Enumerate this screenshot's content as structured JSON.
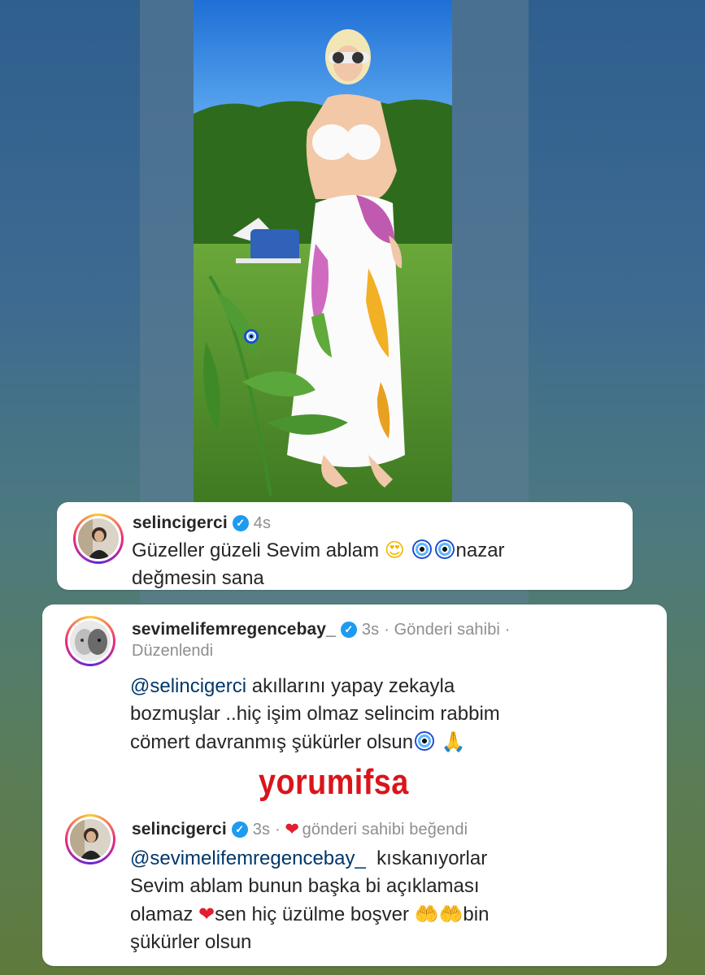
{
  "post": {
    "image_alt": "woman in white floral bikini and sarong standing on lawn",
    "evil_eye_sticker": "nazar-boncugu-icon"
  },
  "comments": [
    {
      "username": "selincigerci",
      "verified": true,
      "time": "4s",
      "meta_extra": "",
      "edited": "",
      "text_parts": [
        "Güzeller güzeli Sevim ablam",
        "nazar",
        "değmesin sana"
      ],
      "emoji": [
        "smiling-face-with-heart-eyes",
        "nazar-boncugu",
        "nazar-boncugu"
      ]
    },
    {
      "username": "sevimelifemregencebay_",
      "verified": true,
      "time": "3s",
      "meta_extra": "· Gönderi sahibi ·",
      "edited": "Düzenlendi",
      "mention": "@selincigerci",
      "text_parts": [
        "akıllarını yapay zekayla",
        "bozmuşlar ..hiç işim olmaz selincim  rabbim",
        "cömert davranmış şükürler  olsun"
      ],
      "emoji": [
        "nazar-boncugu",
        "folded-hands"
      ]
    },
    {
      "username": "selincigerci",
      "verified": true,
      "time": "3s",
      "meta_extra": "·",
      "liked_text": "gönderi sahibi beğendi",
      "mention": "@sevimelifemregencebay_",
      "text_parts": [
        "kıskanıyorlar",
        "Sevim ablam bunun başka bi açıklaması",
        "olamaz",
        "sen hiç üzülme boşver",
        "bin",
        "şükürler olsun"
      ],
      "emoji": [
        "red-heart",
        "palms-up",
        "palms-up"
      ]
    }
  ],
  "watermark": "yorumifsa",
  "colors": {
    "mention": "#00376b",
    "verified": "#1d9bf0",
    "watermark": "#d9151b",
    "meta": "#8e8e8e"
  }
}
